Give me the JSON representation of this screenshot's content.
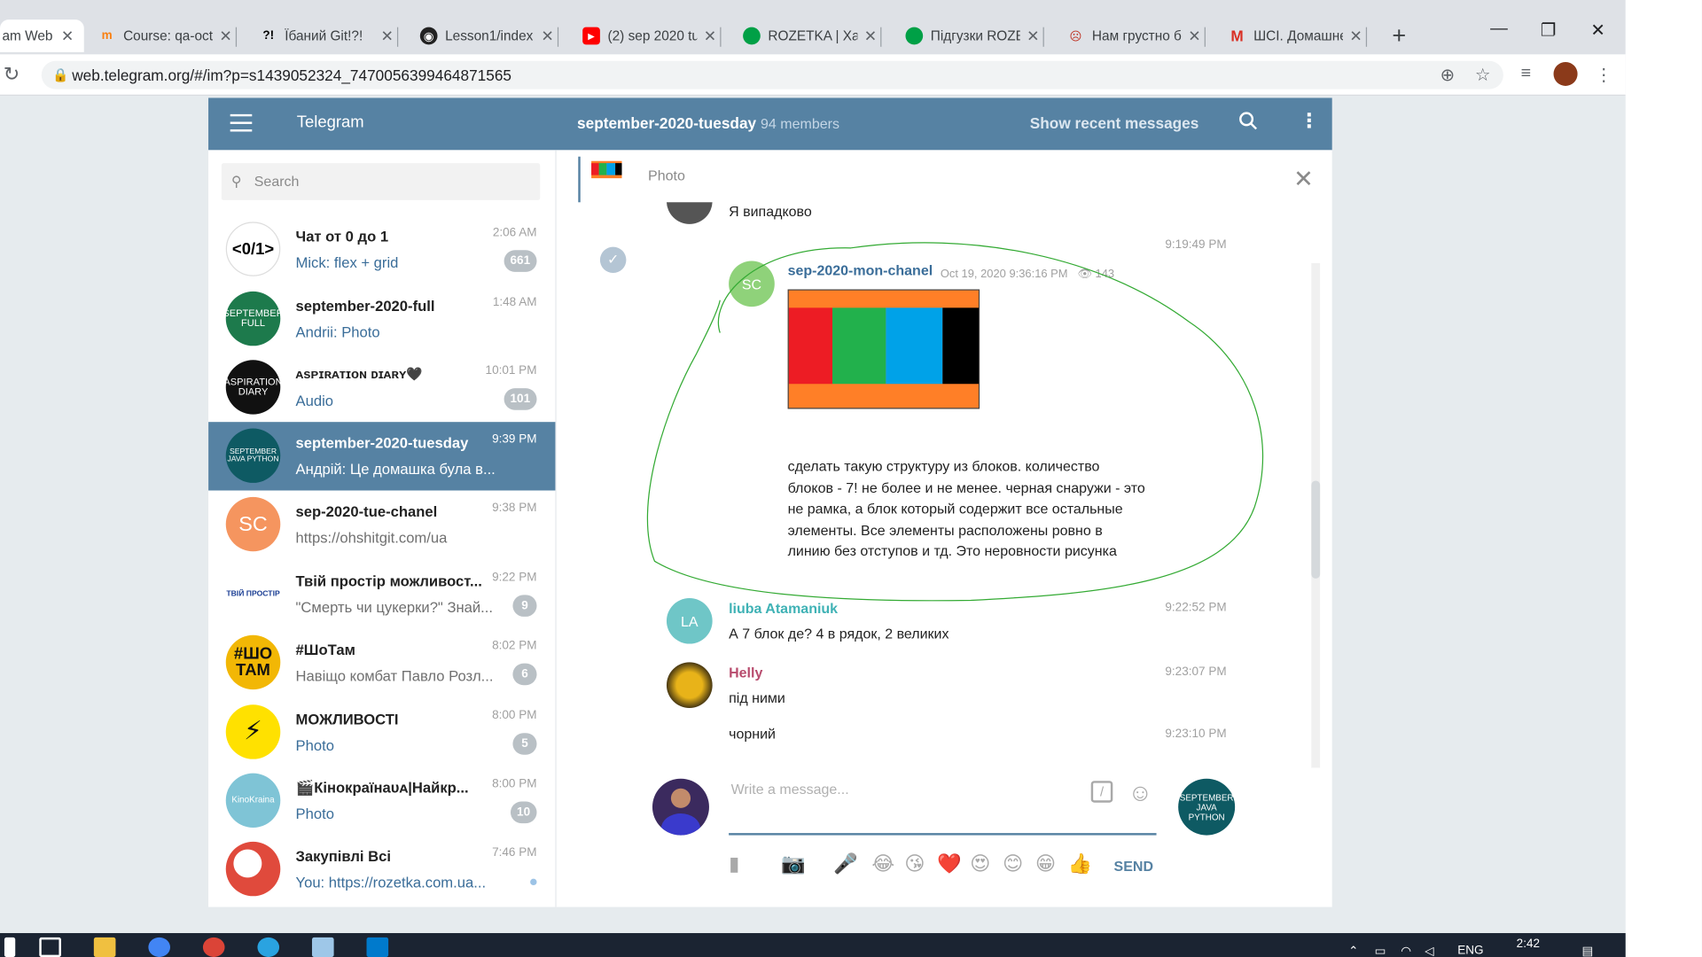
{
  "browser": {
    "tabs": [
      {
        "title": "am Web",
        "icon": "telegram-icon"
      },
      {
        "title": "Course: qa-oct",
        "icon": "moodle-icon"
      },
      {
        "title": "Їбаний Git!?!",
        "icon": "git-icon"
      },
      {
        "title": "Lesson1/index",
        "icon": "github-icon"
      },
      {
        "title": "(2) sep 2020 tu",
        "icon": "youtube-icon"
      },
      {
        "title": "ROZETKA | Хар",
        "icon": "rozetka-icon"
      },
      {
        "title": "Підгузки ROZE",
        "icon": "rozetka-icon"
      },
      {
        "title": "Нам грустно б",
        "icon": "sad-icon"
      },
      {
        "title": "ШСІ. Домашнє",
        "icon": "gmail-icon"
      }
    ],
    "url": "web.telegram.org/#/im?p=s1439052324_7470056399464871565"
  },
  "telegram": {
    "app_title": "Telegram",
    "chat_title": "september-2020-tuesday",
    "members": "94 members",
    "show_recent": "Show recent messages",
    "search_placeholder": "Search",
    "pinned_label": "Photo",
    "dialogs": [
      {
        "name": "Чат от 0 до 1",
        "msg": "Mick: flex + grid",
        "time": "2:06 AM",
        "badge": "661",
        "avatar_text": "<0/1>",
        "avatar_color": "#ffffff"
      },
      {
        "name": "september-2020-full",
        "msg": "Andrii: Photo",
        "time": "1:48 AM",
        "badge": "",
        "avatar_text": "SEPTEMBER FULL",
        "avatar_color": "#1d7a4c"
      },
      {
        "name": "ᴀsᴘɪʀᴀᴛɪᴏɴ ᴅɪᴀʀʏ🖤",
        "msg": "Audio",
        "time": "10:01 PM",
        "badge": "101",
        "avatar_text": "ASPIRATION DIARY",
        "avatar_color": "#111111"
      },
      {
        "name": "september-2020-tuesday",
        "msg": "Андрій: Це домашка була в...",
        "time": "9:39 PM",
        "badge": "",
        "avatar_text": "SEPTEMBER JAVA PYTHON",
        "avatar_color": "#0e5a63"
      },
      {
        "name": "sep-2020-tue-chanel",
        "msg": "https://ohshitgit.com/ua",
        "time": "9:38 PM",
        "badge": "",
        "avatar_text": "SC",
        "avatar_color": "#f5955f"
      },
      {
        "name": "Твій простір можливост...",
        "msg": "\"Смерть чи цукерки?\" Знай...",
        "time": "9:22 PM",
        "badge": "9",
        "avatar_text": "ТВІЙ ПРОСТІР",
        "avatar_color": "#ffffff"
      },
      {
        "name": "#ШоТам",
        "msg": "Навіщо комбат Павло Розл...",
        "time": "8:02 PM",
        "badge": "6",
        "avatar_text": "#ШО ТАМ",
        "avatar_color": "#f2b705"
      },
      {
        "name": "МОЖЛИВОСТІ",
        "msg": "Photo",
        "time": "8:00 PM",
        "badge": "5",
        "avatar_text": "⚡",
        "avatar_color": "#ffe100"
      },
      {
        "name": "🎬Кінокраїнаᴜᴀ|Найкр...",
        "msg": "Photo",
        "time": "8:00 PM",
        "badge": "10",
        "avatar_text": "KinoKraina",
        "avatar_color": "#7fc4d6"
      },
      {
        "name": "Закупівлі Всі",
        "msg": "You: https://rozetka.com.ua...",
        "time": "7:46 PM",
        "badge": "",
        "avatar_text": "",
        "avatar_color": "#e04a3c"
      }
    ],
    "messages": {
      "top_text": "Я випадково",
      "fwd_time": "9:19:49 PM",
      "fwd_channel": "sep-2020-mon-chanel",
      "fwd_date": "Oct 19, 2020 9:36:16 PM",
      "fwd_views": "143",
      "fwd_avatar": "SC",
      "fwd_text": "сделать такую структуру из блоков. количество блоков - 7! не более и не менее. черная снаружи - это не рамка, а блок который содержит все остальные элементы. Все элементы расположены ровно в линию без отступов и тд. Это неровности рисунка",
      "m1_author": "liuba Atamaniuk",
      "m1_avatar": "LA",
      "m1_time": "9:22:52 PM",
      "m1_text": "А 7 блок де? 4 в рядок, 2 великих",
      "m2_author": "Helly",
      "m2_time": "9:23:07 PM",
      "m2_text": "під ними",
      "m3_time": "9:23:10 PM",
      "m3_text": "чорний"
    },
    "compose_placeholder": "Write a message...",
    "peer_avatar_text": "SEPTEMBER JAVA PYTHON",
    "send_label": "SEND",
    "emojis": [
      "😂",
      "😘",
      "❤️",
      "😍",
      "😊",
      "😁",
      "👍"
    ]
  },
  "taskbar": {
    "lang": "ENG",
    "clock": "2:42"
  },
  "colors": {
    "header": "#5682a3",
    "active_dialog": "#5682a3",
    "swatch_red": "#ed1c24",
    "swatch_green": "#22b14c",
    "swatch_blue": "#00a2e8",
    "swatch_black": "#000000",
    "swatch_orange": "#ff7f27"
  }
}
